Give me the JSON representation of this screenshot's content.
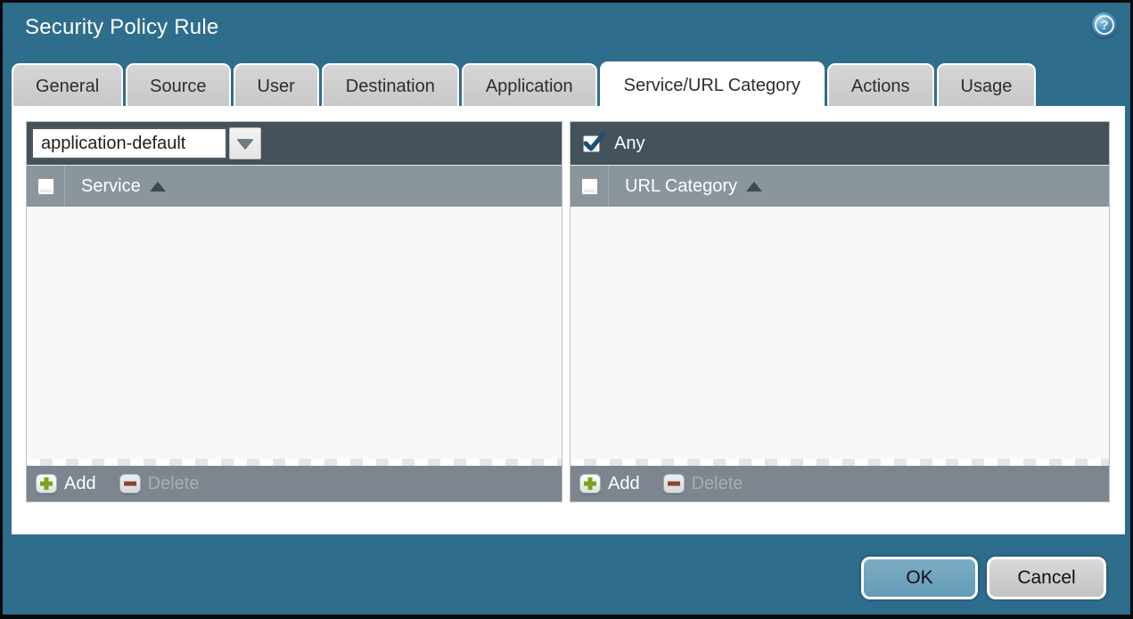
{
  "dialog": {
    "title": "Security Policy Rule",
    "help_tooltip": "?"
  },
  "tabs": [
    {
      "label": "General",
      "active": false
    },
    {
      "label": "Source",
      "active": false
    },
    {
      "label": "User",
      "active": false
    },
    {
      "label": "Destination",
      "active": false
    },
    {
      "label": "Application",
      "active": false
    },
    {
      "label": "Service/URL Category",
      "active": true
    },
    {
      "label": "Actions",
      "active": false
    },
    {
      "label": "Usage",
      "active": false
    }
  ],
  "service_panel": {
    "dropdown_value": "application-default",
    "select_all_checked": false,
    "column_header": "Service",
    "sort_direction": "asc",
    "rows": [],
    "add_label": "Add",
    "delete_label": "Delete",
    "delete_enabled": false
  },
  "url_category_panel": {
    "any_label": "Any",
    "any_checked": true,
    "select_all_checked": false,
    "column_header": "URL Category",
    "sort_direction": "asc",
    "rows": [],
    "add_label": "Add",
    "delete_label": "Delete",
    "delete_enabled": false
  },
  "footer": {
    "ok_label": "OK",
    "cancel_label": "Cancel"
  },
  "colors": {
    "background_teal": "#2f6d8d",
    "toolbar_dark": "#43525b",
    "header_gray": "#8b959c",
    "footer_gray": "#7d868e",
    "ok_button": "#6ba3bd",
    "cancel_button": "#cccccc",
    "add_plus_green": "#7ca21d",
    "delete_minus_red": "#8e4236",
    "checkmark_blue": "#1d4f72"
  }
}
